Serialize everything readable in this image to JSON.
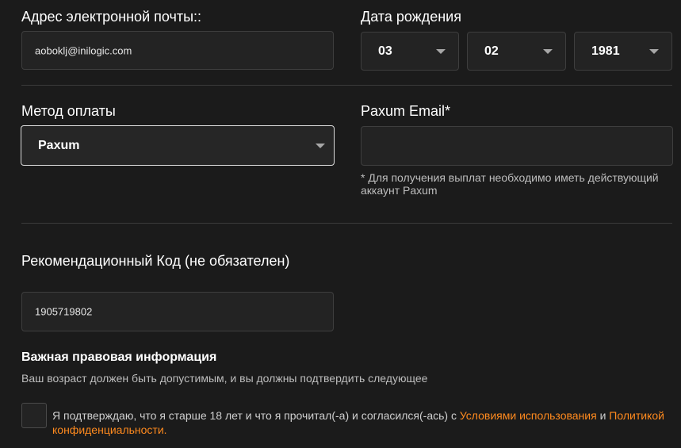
{
  "email": {
    "label": "Адрес электронной почты::",
    "value": "aoboklj@inilogic.com"
  },
  "birthdate": {
    "label": "Дата рождения",
    "day": "03",
    "month": "02",
    "year": "1981"
  },
  "payment": {
    "label": "Метод оплаты",
    "selected": "Paxum"
  },
  "paxum_email": {
    "label": "Paxum Email*",
    "value": "",
    "hint": "* Для получения выплат необходимо иметь действующий аккаунт Paxum"
  },
  "referral": {
    "label": "Рекомендационный Код (не обязателен)",
    "value": "1905719802"
  },
  "legal": {
    "title": "Важная правовая информация",
    "subtitle": "Ваш возраст должен быть допустимым, и вы должны подтвердить следующее",
    "consent_prefix": "Я подтверждаю, что я старше 18 лет и что я прочитал(-а) и согласился(-ась) с ",
    "terms_link": "Условиями использования",
    "and": " и ",
    "privacy_link": "Политикой конфиденциальности",
    "period": ".",
    "checked": false
  },
  "colors": {
    "background": "#1b1b1b",
    "field": "#232323",
    "link": "#ff8a1e"
  }
}
